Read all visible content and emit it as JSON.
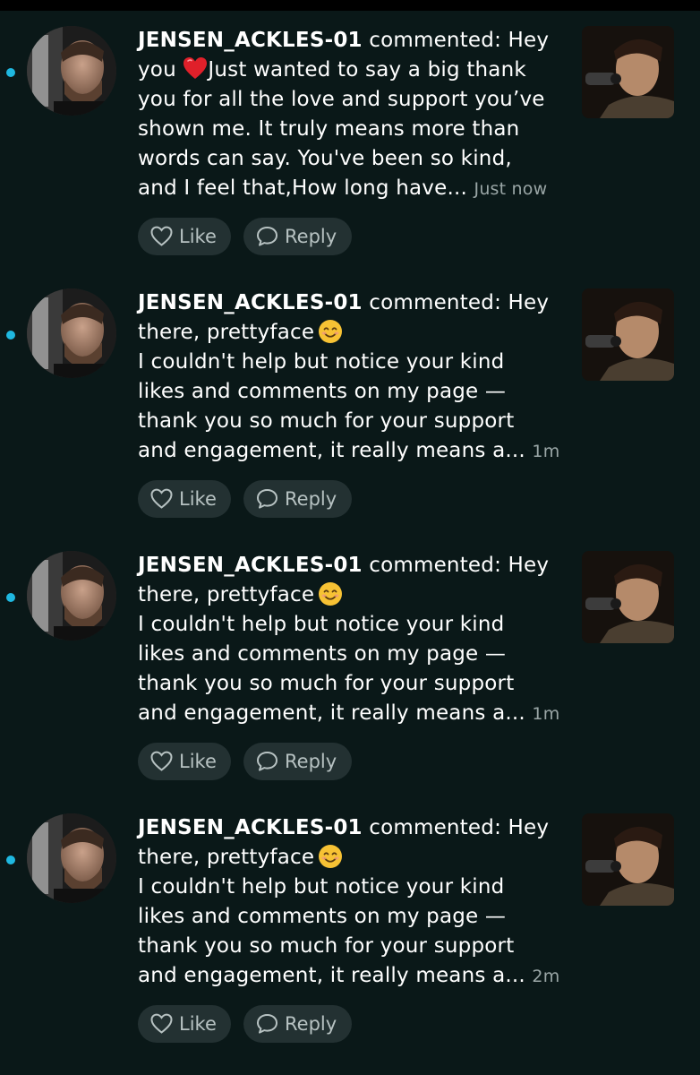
{
  "notifications": [
    {
      "username": "JENSEN_ACKLES-01",
      "lines": [
        " commented: Hey",
        "you ",
        "Just wanted to say a big thank",
        "you for all the love and support you’ve",
        "shown me. It truly means more than",
        "words can say. You've been so kind,",
        "and I feel that,How long have..."
      ],
      "emoji": "heart",
      "time": "Just now",
      "like_label": "Like",
      "reply_label": "Reply"
    },
    {
      "username": "JENSEN_ACKLES-01",
      "lines": [
        " commented: Hey",
        "there, prettyface",
        "I couldn't help but notice your kind",
        "likes and comments on my page —",
        "thank you so much for your support",
        "and engagement, it really means a..."
      ],
      "emoji": "smiling-face",
      "time": "1m",
      "like_label": "Like",
      "reply_label": "Reply"
    },
    {
      "username": "JENSEN_ACKLES-01",
      "lines": [
        " commented: Hey",
        "there, prettyface",
        "I couldn't help but notice your kind",
        "likes and comments on my page —",
        "thank you so much for your support",
        "and engagement, it really means a..."
      ],
      "emoji": "smiling-face",
      "time": "1m",
      "like_label": "Like",
      "reply_label": "Reply"
    },
    {
      "username": "JENSEN_ACKLES-01",
      "lines": [
        " commented: Hey",
        "there, prettyface",
        "I couldn't help but notice your kind",
        "likes and comments on my page —",
        "thank you so much for your support",
        "and engagement, it really means a..."
      ],
      "emoji": "smiling-face",
      "time": "2m",
      "like_label": "Like",
      "reply_label": "Reply"
    }
  ],
  "colors": {
    "background": "#0a1818",
    "unread_dot": "#1fb8e0",
    "button_bg": "#233132",
    "button_text": "#b7c2c2",
    "timestamp": "#9aa6a6",
    "heart": "#e0202a",
    "smile": "#f7c234"
  }
}
